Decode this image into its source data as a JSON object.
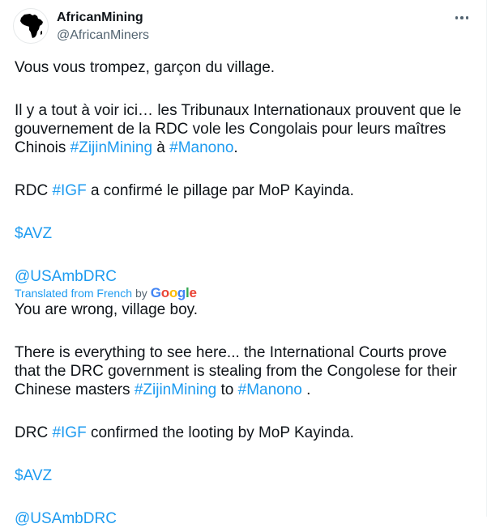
{
  "author": {
    "display_name": "AfricanMining",
    "handle": "@AfricanMiners",
    "avatar_icon": "africa-map-icon"
  },
  "more_icon": "more-options-icon",
  "original": {
    "p1": "Vous vous trompez, garçon du village.",
    "p2_text1": "Il y a tout à voir ici… les Tribunaux Internationaux prouvent que le gouvernement de la RDC vole les Congolais pour leurs maîtres Chinois ",
    "p2_tag1": "#ZijinMining",
    "p2_text2": " à ",
    "p2_tag2": "#Manono",
    "p2_text3": ".",
    "p3_text1": "RDC ",
    "p3_tag": "#IGF",
    "p3_text2": " a confirmé le pillage par MoP Kayinda.",
    "cashtag": "$AVZ",
    "mention": "@USAmbDRC"
  },
  "translation": {
    "label": "Translated from French",
    "by": "by",
    "provider": "Google"
  },
  "translated": {
    "p1": "You are wrong, village boy.",
    "p2_text1": "There is everything to see here... the International Courts prove that the DRC government is stealing from the Congolese for their Chinese masters ",
    "p2_tag1": "#ZijinMining",
    "p2_text2": " to ",
    "p2_tag2": "#Manono",
    "p2_text3": " .",
    "p3_text1": "DRC ",
    "p3_tag": "#IGF",
    "p3_text2": " confirmed the looting by MoP Kayinda.",
    "cashtag": "$AVZ",
    "mention": "@USAmbDRC"
  },
  "colors": {
    "link": "#1d9bf0",
    "text": "#0f1419",
    "secondary": "#536471"
  }
}
